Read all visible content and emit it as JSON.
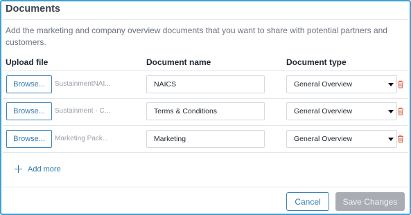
{
  "header": {
    "title": "Documents",
    "description": "Add the marketing and company overview documents that you want to share with potential partners and customers."
  },
  "columns": {
    "upload": "Upload file",
    "name": "Document name",
    "type": "Document type"
  },
  "rows": [
    {
      "browse_label": "Browse...",
      "file_name": "SustainmentNAI...",
      "doc_name": "NAICS",
      "doc_type": "General Overview"
    },
    {
      "browse_label": "Browse...",
      "file_name": "Sustainment - C...",
      "doc_name": "Terms & Conditions",
      "doc_type": "General Overview"
    },
    {
      "browse_label": "Browse...",
      "file_name": "Marketing Pack...",
      "doc_name": "Marketing",
      "doc_type": "General Overview"
    }
  ],
  "add_more_label": "Add more",
  "footer": {
    "cancel_label": "Cancel",
    "save_label": "Save Changes"
  },
  "colors": {
    "accent": "#2f7bb5",
    "frame": "#3aa0d4",
    "delete_icon": "#e0664a",
    "save_disabled": "#a9adb3"
  },
  "icons": {
    "delete": "trash-icon",
    "add": "plus-icon",
    "select": "chevron-down-icon"
  }
}
